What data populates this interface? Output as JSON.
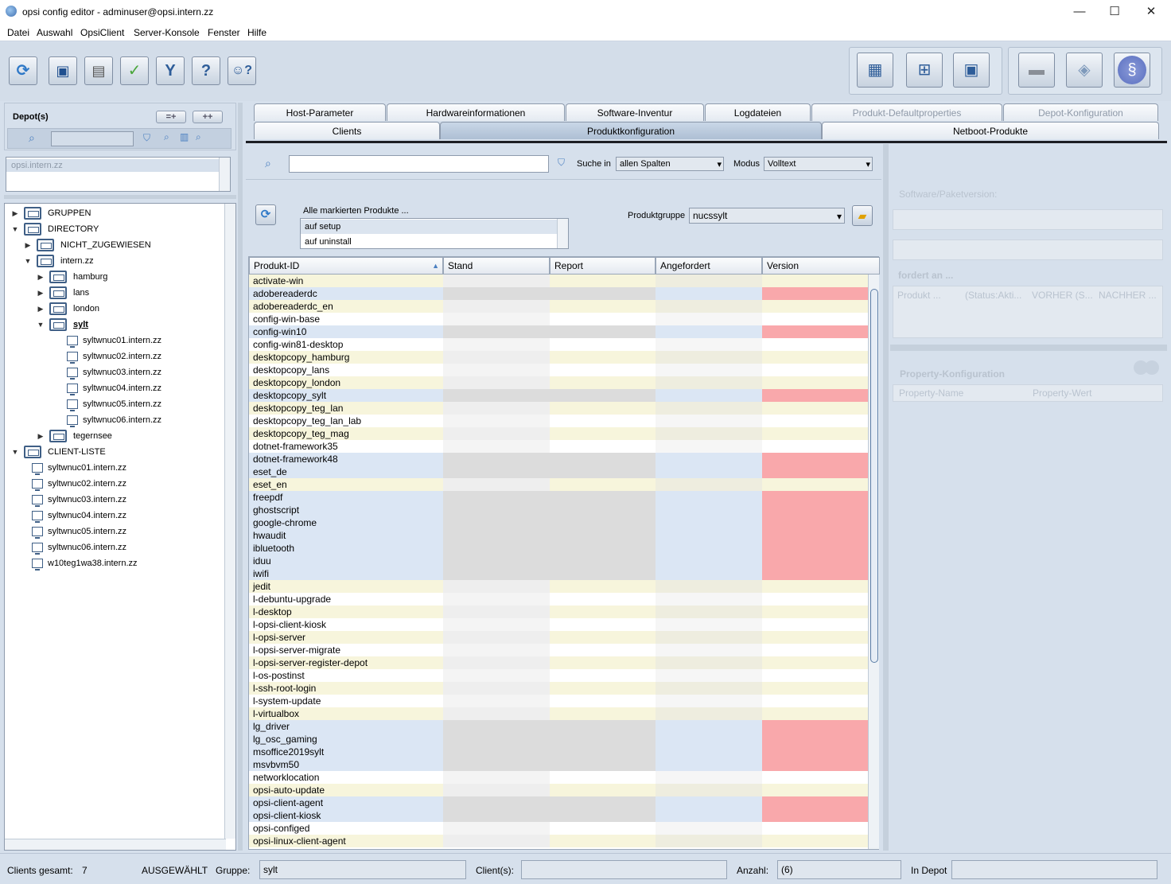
{
  "window": {
    "title": "opsi config editor - adminuser@opsi.intern.zz"
  },
  "menu": [
    "Datei",
    "Auswahl",
    "OpsiClient",
    "Server-Konsole",
    "Fenster",
    "Hilfe"
  ],
  "depot": {
    "label": "Depot(s)",
    "add_label": "=+",
    "add_all_label": "++",
    "selected": "opsi.intern.zz"
  },
  "tree": [
    {
      "label": "GRUPPEN",
      "level": 0,
      "type": "folder",
      "expanded": false
    },
    {
      "label": "DIRECTORY",
      "level": 0,
      "type": "folder",
      "expanded": true
    },
    {
      "label": "NICHT_ZUGEWIESEN",
      "level": 1,
      "type": "folder",
      "expanded": false
    },
    {
      "label": "intern.zz",
      "level": 1,
      "type": "folder",
      "expanded": true
    },
    {
      "label": "hamburg",
      "level": 2,
      "type": "folder",
      "expanded": false
    },
    {
      "label": "lans",
      "level": 2,
      "type": "folder",
      "expanded": false
    },
    {
      "label": "london",
      "level": 2,
      "type": "folder",
      "expanded": false
    },
    {
      "label": "sylt",
      "level": 2,
      "type": "folder",
      "expanded": true,
      "selected": true
    },
    {
      "label": "syltwnuc01.intern.zz",
      "level": 3,
      "type": "client"
    },
    {
      "label": "syltwnuc02.intern.zz",
      "level": 3,
      "type": "client"
    },
    {
      "label": "syltwnuc03.intern.zz",
      "level": 3,
      "type": "client"
    },
    {
      "label": "syltwnuc04.intern.zz",
      "level": 3,
      "type": "client"
    },
    {
      "label": "syltwnuc05.intern.zz",
      "level": 3,
      "type": "client"
    },
    {
      "label": "syltwnuc06.intern.zz",
      "level": 3,
      "type": "client"
    },
    {
      "label": "tegernsee",
      "level": 2,
      "type": "folder",
      "expanded": false
    },
    {
      "label": "CLIENT-LISTE",
      "level": 0,
      "type": "folder",
      "expanded": true
    },
    {
      "label": "syltwnuc01.intern.zz",
      "level": 1,
      "type": "client"
    },
    {
      "label": "syltwnuc02.intern.zz",
      "level": 1,
      "type": "client"
    },
    {
      "label": "syltwnuc03.intern.zz",
      "level": 1,
      "type": "client"
    },
    {
      "label": "syltwnuc04.intern.zz",
      "level": 1,
      "type": "client"
    },
    {
      "label": "syltwnuc05.intern.zz",
      "level": 1,
      "type": "client"
    },
    {
      "label": "syltwnuc06.intern.zz",
      "level": 1,
      "type": "client"
    },
    {
      "label": "w10teg1wa38.intern.zz",
      "level": 1,
      "type": "client"
    }
  ],
  "tabs_top": [
    {
      "label": "Host-Parameter",
      "disabled": false
    },
    {
      "label": "Hardwareinformationen",
      "disabled": false
    },
    {
      "label": "Software-Inventur",
      "disabled": false
    },
    {
      "label": "Logdateien",
      "disabled": false
    },
    {
      "label": "Produkt-Defaultproperties",
      "disabled": true
    },
    {
      "label": "Depot-Konfiguration",
      "disabled": true
    }
  ],
  "tabs_bottom": [
    {
      "label": "Clients",
      "active": false
    },
    {
      "label": "Produktkonfiguration",
      "active": true
    },
    {
      "label": "Netboot-Produkte",
      "active": false
    }
  ],
  "search": {
    "placeholder": "",
    "in_label": "Suche in",
    "in_value": "allen Spalten",
    "mode_label": "Modus",
    "mode_value": "Volltext"
  },
  "marked": {
    "label": "Alle markierten Produkte ...",
    "options": [
      "auf setup",
      "auf uninstall"
    ]
  },
  "product_group": {
    "label": "Produktgruppe",
    "value": "nucssylt"
  },
  "table": {
    "columns": [
      "Produkt-ID",
      "Stand",
      "Report",
      "Angefordert",
      "Version"
    ],
    "rows": [
      {
        "id": "activate-win",
        "state": "n"
      },
      {
        "id": "adobereaderdc",
        "state": "r"
      },
      {
        "id": "adobereaderdc_en",
        "state": "n"
      },
      {
        "id": "config-win-base",
        "state": "n"
      },
      {
        "id": "config-win10",
        "state": "r"
      },
      {
        "id": "config-win81-desktop",
        "state": "n"
      },
      {
        "id": "desktopcopy_hamburg",
        "state": "n"
      },
      {
        "id": "desktopcopy_lans",
        "state": "n"
      },
      {
        "id": "desktopcopy_london",
        "state": "n"
      },
      {
        "id": "desktopcopy_sylt",
        "state": "r"
      },
      {
        "id": "desktopcopy_teg_lan",
        "state": "n"
      },
      {
        "id": "desktopcopy_teg_lan_lab",
        "state": "n"
      },
      {
        "id": "desktopcopy_teg_mag",
        "state": "n"
      },
      {
        "id": "dotnet-framework35",
        "state": "n"
      },
      {
        "id": "dotnet-framework48",
        "state": "r"
      },
      {
        "id": "eset_de",
        "state": "r"
      },
      {
        "id": "eset_en",
        "state": "n"
      },
      {
        "id": "freepdf",
        "state": "r"
      },
      {
        "id": "ghostscript",
        "state": "r"
      },
      {
        "id": "google-chrome",
        "state": "r"
      },
      {
        "id": "hwaudit",
        "state": "r"
      },
      {
        "id": "ibluetooth",
        "state": "r"
      },
      {
        "id": "iduu",
        "state": "r"
      },
      {
        "id": "iwifi",
        "state": "r"
      },
      {
        "id": "jedit",
        "state": "n"
      },
      {
        "id": "l-debuntu-upgrade",
        "state": "n"
      },
      {
        "id": "l-desktop",
        "state": "n"
      },
      {
        "id": "l-opsi-client-kiosk",
        "state": "n"
      },
      {
        "id": "l-opsi-server",
        "state": "n"
      },
      {
        "id": "l-opsi-server-migrate",
        "state": "n"
      },
      {
        "id": "l-opsi-server-register-depot",
        "state": "n"
      },
      {
        "id": "l-os-postinst",
        "state": "n"
      },
      {
        "id": "l-ssh-root-login",
        "state": "n"
      },
      {
        "id": "l-system-update",
        "state": "n"
      },
      {
        "id": "l-virtualbox",
        "state": "n"
      },
      {
        "id": "lg_driver",
        "state": "r"
      },
      {
        "id": "lg_osc_gaming",
        "state": "r"
      },
      {
        "id": "msoffice2019sylt",
        "state": "r"
      },
      {
        "id": "msvbvm50",
        "state": "r"
      },
      {
        "id": "networklocation",
        "state": "n"
      },
      {
        "id": "opsi-auto-update",
        "state": "n"
      },
      {
        "id": "opsi-client-agent",
        "state": "r"
      },
      {
        "id": "opsi-client-kiosk",
        "state": "r"
      },
      {
        "id": "opsi-configed",
        "state": "n"
      },
      {
        "id": "opsi-linux-client-agent",
        "state": "n"
      }
    ]
  },
  "right": {
    "software_label": "Software/Paketversion:",
    "requires_label": "fordert an ...",
    "req_columns": [
      "Produkt ...",
      "(Status:Akti...",
      "VORHER (S...",
      "NACHHER ..."
    ],
    "property_label": "Property-Konfiguration",
    "prop_columns": [
      "Property-Name",
      "Property-Wert"
    ]
  },
  "status": {
    "clients_total_label": "Clients gesamt:",
    "clients_total": "7",
    "selected_label": "AUSGEWÄHLT",
    "group_label": "Gruppe:",
    "group_value": "sylt",
    "clients_label": "Client(s):",
    "clients_value": "",
    "count_label": "Anzahl:",
    "count_value": "(6)",
    "in_depot_label": "In Depot",
    "in_depot_value": ""
  },
  "colors": {
    "accent": "#aebfd4",
    "yellow_row": "#f7f5dc",
    "blue_row": "#dbe6f4",
    "red_cell": "#f9a8ab"
  }
}
